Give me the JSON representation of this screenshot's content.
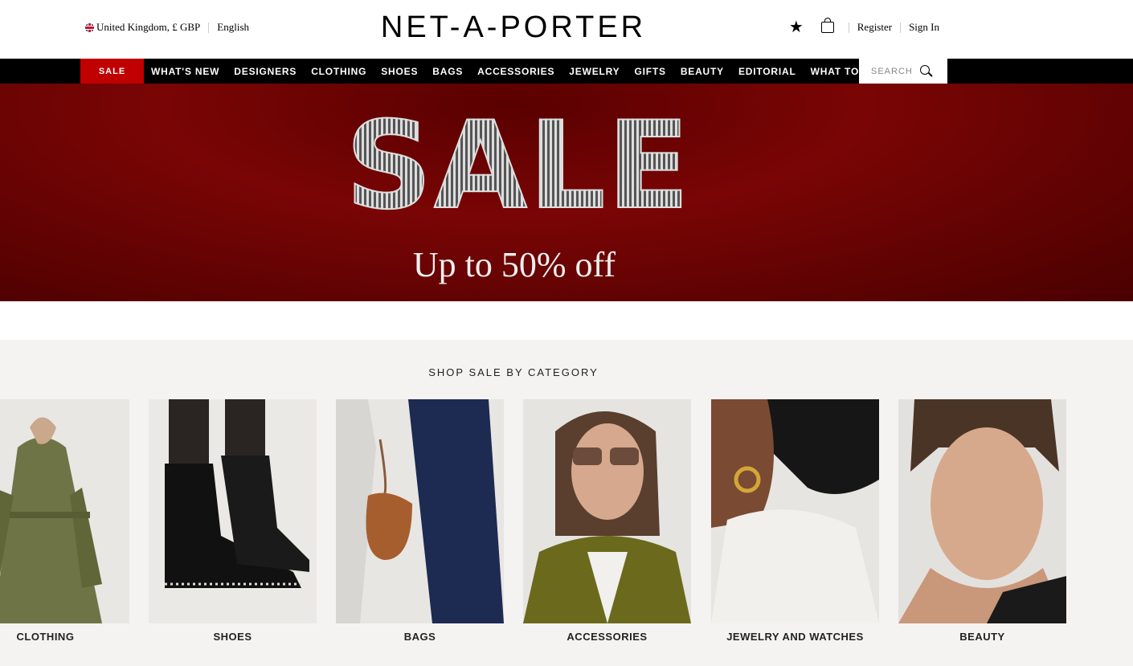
{
  "header": {
    "locale": "United Kingdom, £ GBP",
    "language": "English",
    "logo": "NET-A-PORTER",
    "register": "Register",
    "sign_in": "Sign In",
    "icons": [
      "uk-flag-icon",
      "wishlist-star-icon",
      "shopping-bag-icon",
      "search-icon"
    ]
  },
  "nav": {
    "sale": "SALE",
    "items": [
      "WHAT'S NEW",
      "DESIGNERS",
      "CLOTHING",
      "SHOES",
      "BAGS",
      "ACCESSORIES",
      "JEWELRY",
      "GIFTS",
      "BEAUTY",
      "EDITORIAL",
      "WHAT TO WEAR"
    ],
    "search_placeholder": "SEARCH"
  },
  "hero": {
    "title": "SALE",
    "subtitle": "Up to 50% off"
  },
  "categories": {
    "title": "SHOP SALE BY CATEGORY",
    "items": [
      "CLOTHING",
      "SHOES",
      "BAGS",
      "ACCESSORIES",
      "JEWELRY AND WATCHES",
      "BEAUTY"
    ]
  },
  "colors": {
    "sale_red": "#c00000",
    "nav_black": "#000000",
    "hero_red": "#6a0303",
    "category_bg": "#f4f3f1"
  }
}
